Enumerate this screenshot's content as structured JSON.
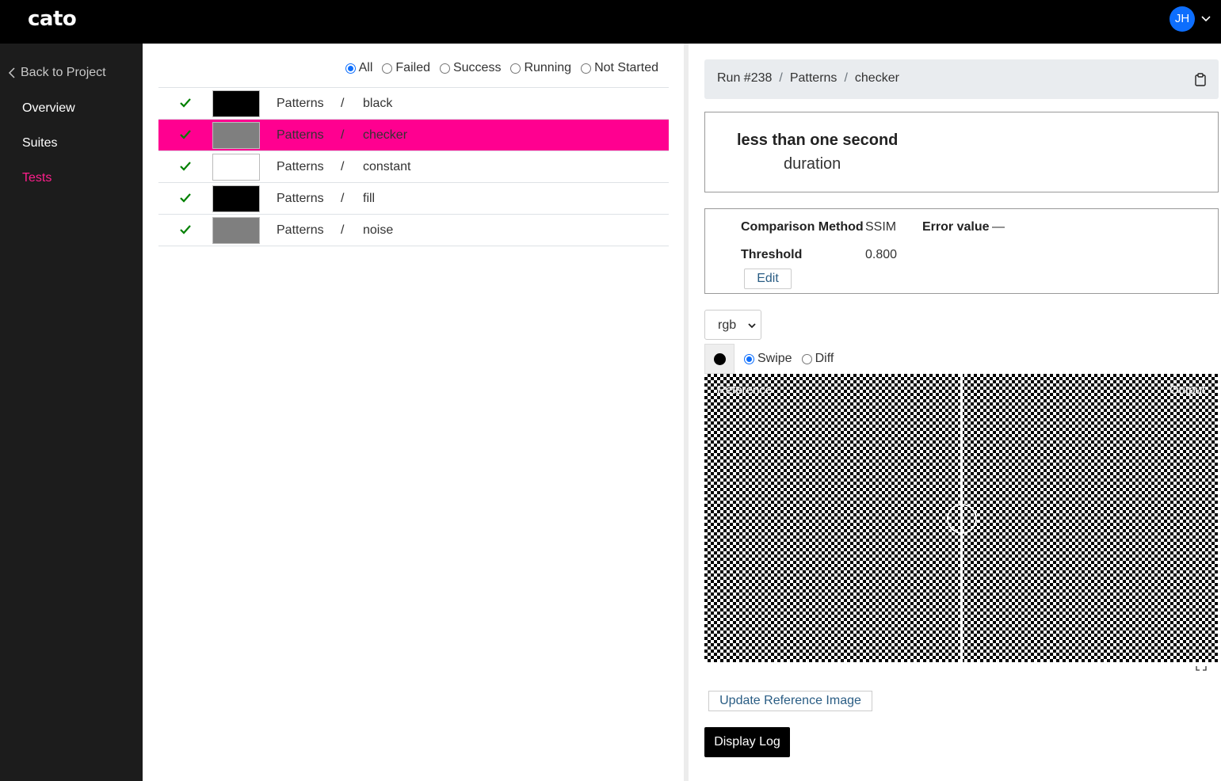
{
  "app": {
    "logo": "cato"
  },
  "header": {
    "user_initials": "JH",
    "avatar_color": "#0d6efd"
  },
  "sidebar": {
    "back_label": "Back to Project",
    "items": [
      {
        "label": "Overview",
        "active": false
      },
      {
        "label": "Suites",
        "active": false
      },
      {
        "label": "Tests",
        "active": true
      }
    ]
  },
  "filters": {
    "options": [
      "All",
      "Failed",
      "Success",
      "Running",
      "Not Started"
    ],
    "selected": "All"
  },
  "tests": [
    {
      "suite": "Patterns",
      "name": "black",
      "status": "success",
      "thumb_color": "#000000",
      "selected": false
    },
    {
      "suite": "Patterns",
      "name": "checker",
      "status": "success",
      "thumb_color": "#7f7f7f",
      "selected": true
    },
    {
      "suite": "Patterns",
      "name": "constant",
      "status": "success",
      "thumb_color": "#ffffff",
      "selected": false
    },
    {
      "suite": "Patterns",
      "name": "fill",
      "status": "success",
      "thumb_color": "#000000",
      "selected": false
    },
    {
      "suite": "Patterns",
      "name": "noise",
      "status": "success",
      "thumb_color": "#7f7f7f",
      "selected": false
    }
  ],
  "separator": "/",
  "detail": {
    "breadcrumb": [
      "Run #238",
      "Patterns",
      "checker"
    ],
    "duration_value": "less than one second",
    "duration_label": "duration",
    "comparison": {
      "method_label": "Comparison Method",
      "method_value": "SSIM",
      "error_label": "Error value",
      "error_value": "—",
      "threshold_label": "Threshold",
      "threshold_value": "0.800",
      "edit_label": "Edit"
    },
    "channel_select": "rgb",
    "view_modes": [
      "Swipe",
      "Diff"
    ],
    "view_mode_selected": "Swipe",
    "viewer": {
      "left_label": "Reference",
      "right_label": "Output"
    },
    "update_reference_label": "Update Reference Image",
    "display_log_label": "Display Log"
  },
  "colors": {
    "accent": "#ff0090",
    "nav_active": "#ff1e8c",
    "success": "#008000"
  }
}
